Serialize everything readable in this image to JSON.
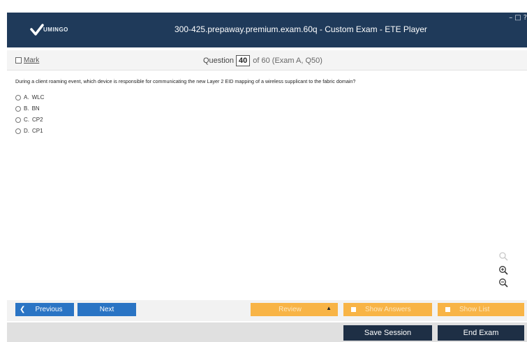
{
  "window": {
    "title": "300-425.prepaway.premium.exam.60q - Custom Exam - ETE Player",
    "logo_text": "UMINGO",
    "controls": [
      "–",
      "□",
      "?"
    ]
  },
  "question_bar": {
    "mark_label": "Mark",
    "question_label": "Question",
    "question_number": "40",
    "of_text": "of 60 (Exam A, Q50)"
  },
  "question": {
    "text": "During a client roaming event, which device is responsible for communicating the new Layer 2 EID mapping of a wireless supplicant to the fabric domain?",
    "options": [
      {
        "letter": "A.",
        "text": "WLC"
      },
      {
        "letter": "B.",
        "text": "BN"
      },
      {
        "letter": "C.",
        "text": "CP2"
      },
      {
        "letter": "D.",
        "text": "CP1"
      }
    ]
  },
  "buttons": {
    "previous": "Previous",
    "next": "Next",
    "review": "Review",
    "show_answers": "Show Answers",
    "show_list": "Show List",
    "save_session": "Save Session",
    "end_exam": "End Exam"
  },
  "colors": {
    "titlebar": "#1f3a5a",
    "nav_button": "#2a74c4",
    "orange_button": "#f8b446",
    "dark_button": "#1e2f45"
  },
  "icons": {
    "logo": "checkmark-logo-icon",
    "search": "search-icon",
    "zoom_in": "zoom-in-icon",
    "zoom_out": "zoom-out-icon",
    "previous": "chevron-left-icon",
    "review_dropdown": "triangle-up-icon"
  }
}
